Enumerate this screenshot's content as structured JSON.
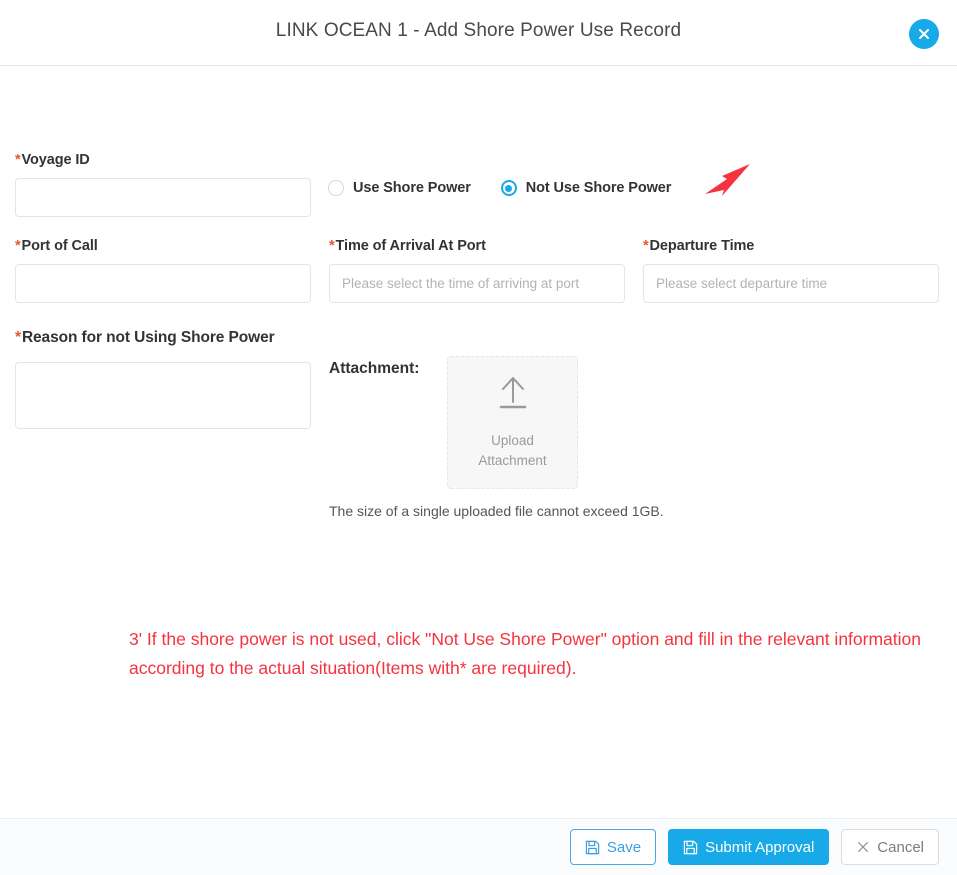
{
  "header": {
    "title": "LINK OCEAN 1 - Add Shore Power Use Record",
    "close_icon": "close-icon",
    "accent_color": "#17a9e8"
  },
  "form": {
    "voyage": {
      "label": "Voyage ID",
      "required_mark": "*",
      "value": "",
      "placeholder": ""
    },
    "shore_power_options": [
      {
        "label": "Use Shore Power",
        "selected": false
      },
      {
        "label": "Not Use Shore Power",
        "selected": true
      }
    ],
    "port_of_call": {
      "label": "Port of Call",
      "required_mark": "*",
      "value": "",
      "placeholder": ""
    },
    "arrival_time": {
      "label": "Time of Arrival At Port",
      "required_mark": "*",
      "value": "",
      "placeholder": "Please select the time of arriving at port"
    },
    "departure_time": {
      "label": "Departure Time",
      "required_mark": "*",
      "value": "",
      "placeholder": "Please select departure time"
    },
    "reason": {
      "label": "Reason for not Using Shore Power",
      "required_mark": "*",
      "value": "",
      "placeholder": ""
    },
    "attachment": {
      "label": "Attachment:",
      "upload_icon": "upload-arrow-icon",
      "upload_caption_line1": "Upload",
      "upload_caption_line2": "Attachment",
      "hint": "The size of a single uploaded file cannot exceed 1GB."
    }
  },
  "annotation": {
    "arrow_color": "#f5333f",
    "note_color": "#f5333f",
    "note": "3' If the shore power is not used, click \"Not Use Shore Power\" option and fill in the relevant information according to the actual situation(Items with* are required)."
  },
  "footer": {
    "save_label": "Save",
    "save_icon": "save-floppy-icon",
    "submit_label": "Submit Approval",
    "submit_icon": "save-floppy-icon",
    "cancel_label": "Cancel",
    "cancel_icon": "close-x-icon"
  }
}
